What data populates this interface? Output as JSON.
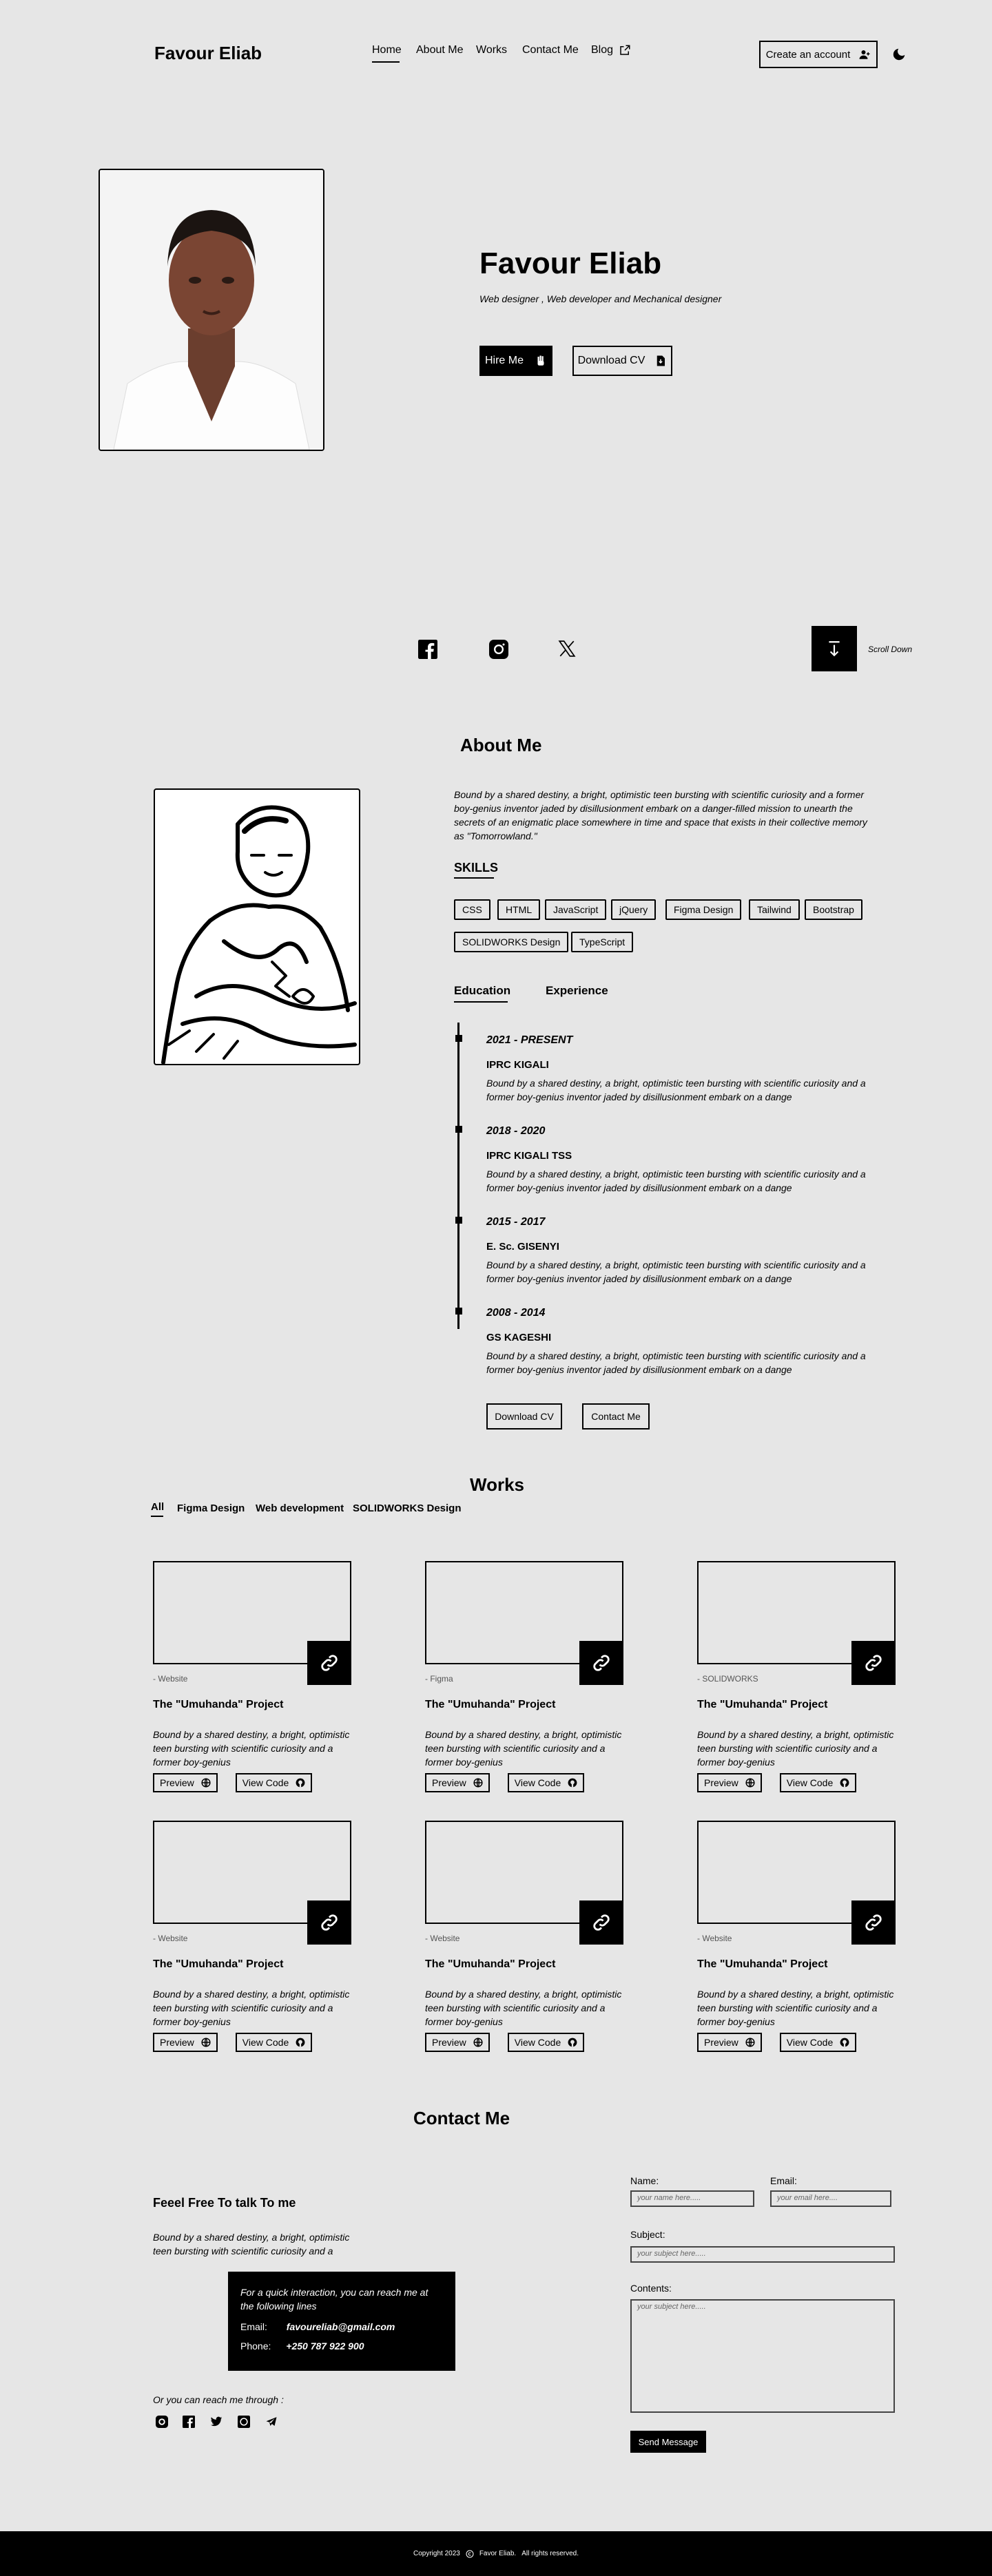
{
  "header": {
    "brand": "Favour Eliab",
    "nav": [
      "Home",
      "About Me",
      "Works",
      "Contact Me",
      "Blog"
    ],
    "create_account": "Create an account"
  },
  "hero": {
    "name": "Favour Eliab",
    "tagline": "Web designer , Web developer and Mechanical designer",
    "hire_me": "Hire Me",
    "download_cv": "Download CV",
    "scroll_down": "Scroll Down"
  },
  "about": {
    "heading": "About Me",
    "bio": "Bound by a shared destiny, a bright, optimistic teen bursting with scientific curiosity and a former boy-genius inventor jaded by disillusionment embark on a danger-filled mission to unearth the secrets of an enigmatic place somewhere in time and space that exists in their collective memory as \"Tomorrowland.\"",
    "skills_heading": "SKILLS",
    "skills": [
      "CSS",
      "HTML",
      "JavaScript",
      "jQuery",
      "Figma Design",
      "Tailwind",
      "Bootstrap",
      "SOLIDWORKS Design",
      "TypeScript"
    ],
    "tabs": [
      "Education",
      "Experience"
    ],
    "timeline": [
      {
        "date": "2021 - PRESENT",
        "school": "IPRC KIGALI",
        "text": "Bound by a shared destiny, a bright, optimistic teen bursting with scientific curiosity and a former boy-genius inventor jaded by disillusionment embark on a dange"
      },
      {
        "date": "2018 - 2020",
        "school": "IPRC KIGALI TSS",
        "text": "Bound by a shared destiny, a bright, optimistic teen bursting with scientific curiosity and a former boy-genius inventor jaded by disillusionment embark on a dange"
      },
      {
        "date": "2015 - 2017",
        "school": "E. Sc. GISENYI",
        "text": "Bound by a shared destiny, a bright, optimistic teen bursting with scientific curiosity and a former boy-genius inventor jaded by disillusionment embark on a dange"
      },
      {
        "date": "2008 - 2014",
        "school": "GS KAGESHI",
        "text": "Bound by a shared destiny, a bright, optimistic teen bursting with scientific curiosity and a former boy-genius inventor jaded by disillusionment embark on a dange"
      }
    ],
    "download_cv": "Download CV",
    "contact_me": "Contact Me"
  },
  "works": {
    "heading": "Works",
    "filters": [
      "All",
      "Figma Design",
      "Web development",
      "SOLIDWORKS Design"
    ],
    "cards": [
      {
        "tag": "Website",
        "title": "The \"Umuhanda\" Project",
        "desc": "Bound by a shared destiny, a bright, optimistic teen bursting with scientific curiosity and a former boy-genius",
        "preview": "Preview",
        "code": "View Code"
      },
      {
        "tag": "Figma",
        "title": "The \"Umuhanda\" Project",
        "desc": "Bound by a shared destiny, a bright, optimistic teen bursting with scientific curiosity and a former boy-genius",
        "preview": "Preview",
        "code": "View Code"
      },
      {
        "tag": "SOLIDWORKS",
        "title": "The \"Umuhanda\" Project",
        "desc": "Bound by a shared destiny, a bright, optimistic teen bursting with scientific curiosity and a former boy-genius",
        "preview": "Preview",
        "code": "View Code"
      },
      {
        "tag": "Website",
        "title": "The \"Umuhanda\" Project",
        "desc": "Bound by a shared destiny, a bright, optimistic teen bursting with scientific curiosity and a former boy-genius",
        "preview": "Preview",
        "code": "View Code"
      },
      {
        "tag": "Website",
        "title": "The \"Umuhanda\" Project",
        "desc": "Bound by a shared destiny, a bright, optimistic teen bursting with scientific curiosity and a former boy-genius",
        "preview": "Preview",
        "code": "View Code"
      },
      {
        "tag": "Website",
        "title": "The \"Umuhanda\" Project",
        "desc": "Bound by a shared destiny, a bright, optimistic teen bursting with scientific curiosity and a former boy-genius",
        "preview": "Preview",
        "code": "View Code"
      }
    ]
  },
  "contact": {
    "heading": "Contact Me",
    "subheading": "Feeel Free To talk To me",
    "intro": "Bound by a shared destiny, a bright, optimistic teen bursting with scientific curiosity and a",
    "box_text": "For a quick interaction, you can reach me at the following lines",
    "email_label": "Email:",
    "email": "favoureliab@gmail.com",
    "phone_label": "Phone:",
    "phone": "+250 787 922 900",
    "reach_through": "Or you can reach me through :",
    "form": {
      "name_label": "Name:",
      "name_placeholder": "your name here.....",
      "email_label": "Email:",
      "email_placeholder": "your email here....",
      "subject_label": "Subject:",
      "subject_placeholder": "your subject here.....",
      "contents_label": "Contents:",
      "contents_placeholder": "your subject here.....",
      "send": "Send Message"
    }
  },
  "footer": {
    "year": "Copyright 2023",
    "owner": "Favor Eliab.",
    "rights": "All rights reserved."
  }
}
